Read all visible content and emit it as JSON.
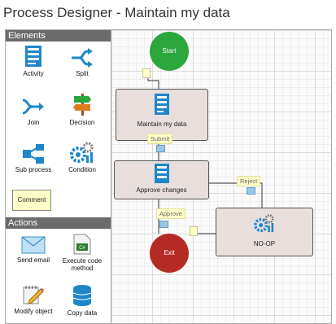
{
  "title": "Process Designer - Maintain my data",
  "elements": {
    "header": "Elements",
    "items": [
      {
        "label": "Activity",
        "icon": "activity-icon"
      },
      {
        "label": "Split",
        "icon": "split-icon"
      },
      {
        "label": "Join",
        "icon": "join-icon"
      },
      {
        "label": "Decision",
        "icon": "decision-icon"
      },
      {
        "label": "Sub process",
        "icon": "sub-process-icon"
      },
      {
        "label": "Condition",
        "icon": "condition-icon"
      }
    ],
    "comment_label": "Comment"
  },
  "actions": {
    "header": "Actions",
    "items": [
      {
        "label": "Send email",
        "icon": "envelope-icon"
      },
      {
        "label": "Execute code method",
        "icon": "code-file-icon",
        "badge": "C#"
      },
      {
        "label": "Modify object",
        "icon": "edit-object-icon"
      },
      {
        "label": "Copy data",
        "icon": "database-icon"
      }
    ]
  },
  "diagram": {
    "start_label": "Start",
    "exit_label": "Exit",
    "nodes": {
      "maintain": "Maintain my data",
      "approve": "Approve changes",
      "noop": "NO-OP"
    },
    "edges": {
      "submit": "Submit",
      "reject": "Reject",
      "approve": "Approve"
    }
  },
  "colors": {
    "start": "#2aa63c",
    "exit": "#b52a24",
    "node_fill": "#e8dfdc",
    "edge_label_fill": "#fffec8",
    "icon_blue": "#1f86c8"
  }
}
